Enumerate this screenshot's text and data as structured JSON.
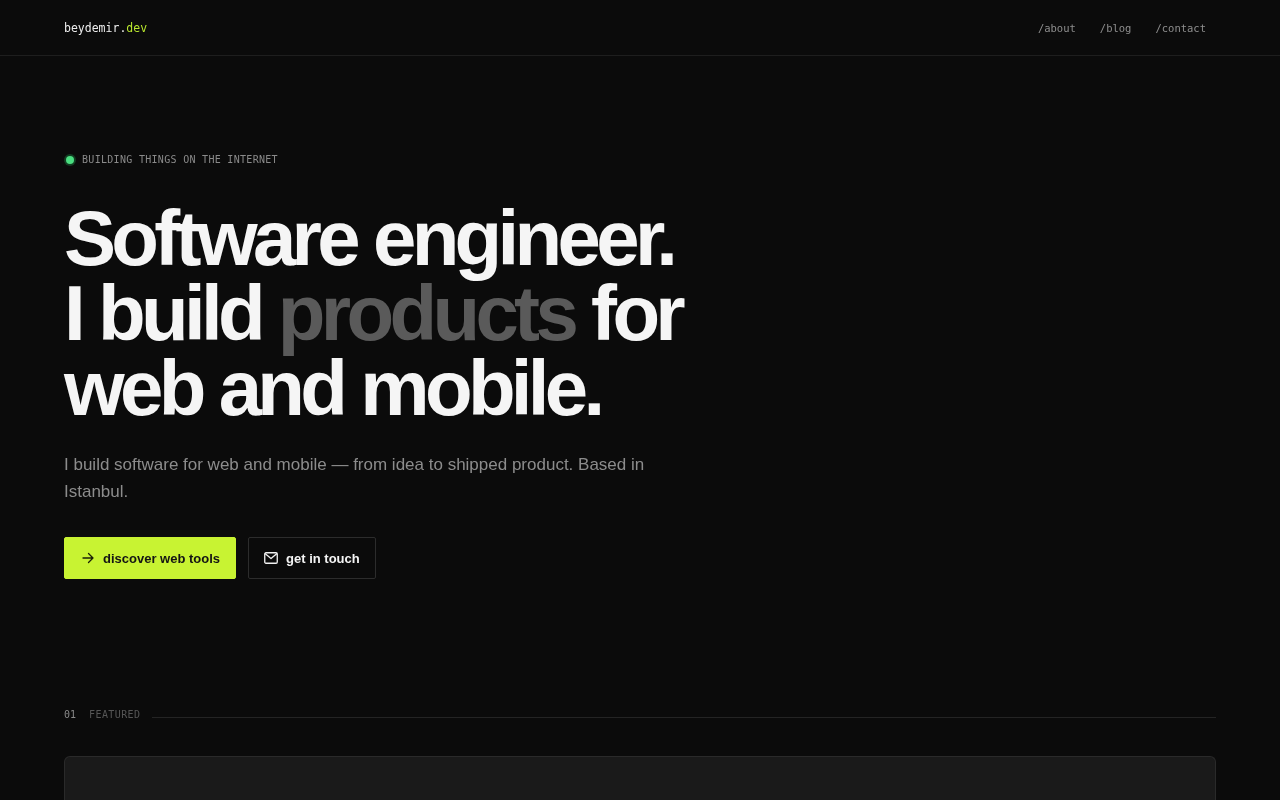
{
  "header": {
    "logo": {
      "text": "beydemir.",
      "accent": "dev"
    },
    "nav": [
      {
        "label": "/about"
      },
      {
        "label": "/blog"
      },
      {
        "label": "/contact"
      }
    ]
  },
  "hero": {
    "status": {
      "label": "BUILDING THINGS ON THE INTERNET"
    },
    "headline": [
      [
        {
          "text": "Software engineer.",
          "muted": false
        }
      ],
      [
        {
          "text": "I build ",
          "muted": false
        },
        {
          "text": "products",
          "muted": true
        },
        {
          "text": " for",
          "muted": false
        }
      ],
      [
        {
          "text": "web and mobile.",
          "muted": false
        }
      ]
    ],
    "lead": "I build software for web and mobile — from idea to shipped product. Based in Istanbul.",
    "actions": [
      {
        "label": "discover web tools",
        "kind": "primary"
      },
      {
        "label": "get in touch",
        "kind": "secondary"
      }
    ]
  },
  "featured": {
    "number": "01",
    "label": "FEATURED"
  }
}
